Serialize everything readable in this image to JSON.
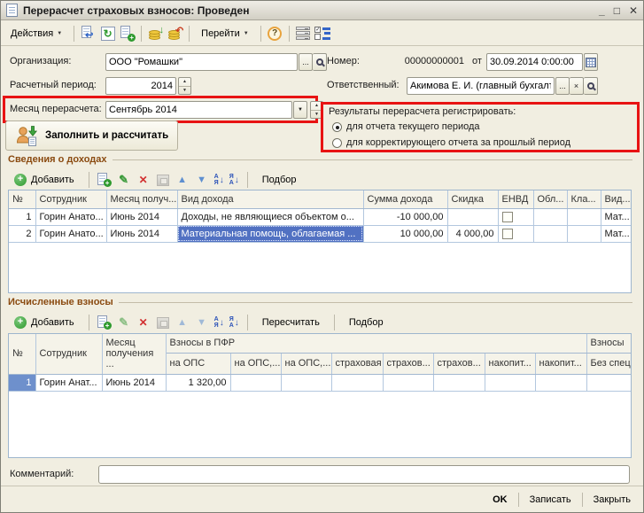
{
  "window": {
    "title": "Перерасчет страховых взносов: Проведен"
  },
  "icons": {
    "minimize": "_",
    "maximize": "□",
    "close": "✕",
    "dropdown": "▼",
    "spin_up": "▲",
    "spin_down": "▼",
    "refresh": "↻",
    "back_arrow": "↩",
    "down_arrow": "↓",
    "undo_arrow": "↶",
    "plus": "+",
    "edit": "✎",
    "delete": "✕",
    "help": "?",
    "ellipsis": "...",
    "clear": "×",
    "check": "✓",
    "sort_a": "А",
    "sort_ya": "Я",
    "sort_arrow": "↓",
    "arrow_up": "▲",
    "arrow_down": "▼"
  },
  "toolbar": {
    "actions": "Действия",
    "goto": "Перейти"
  },
  "form": {
    "org_label": "Организация:",
    "org_value": "ООО \"Ромашки\"",
    "period_label": "Расчетный период:",
    "period_value": "2014",
    "month_label": "Месяц перерасчета:",
    "month_value": "Сентябрь 2014",
    "number_label": "Номер:",
    "number_value": "00000000001",
    "date_prefix": "от",
    "date_value": "30.09.2014 0:00:00",
    "responsible_label": "Ответственный:",
    "responsible_value": "Акимова Е. И. (главный бухгалте",
    "fill_button": "Заполнить и рассчитать"
  },
  "register": {
    "label": "Результаты перерасчета регистрировать:",
    "option_current": "для отчета текущего периода",
    "option_correction": "для корректирующего отчета за прошлый период"
  },
  "income": {
    "title": "Сведения о доходах",
    "add": "Добавить",
    "pick": "Подбор",
    "columns": [
      "№",
      "Сотрудник",
      "Месяц получ...",
      "Вид дохода",
      "Сумма дохода",
      "Скидка",
      "ЕНВД",
      "Обл...",
      "Кла...",
      "Вид..."
    ],
    "rows": [
      {
        "num": "1",
        "employee": "Горин Анато...",
        "month": "Июнь 2014",
        "type": "Доходы, не являющиеся объектом о...",
        "amount": "-10 000,00",
        "discount": "",
        "extra": "Мат..."
      },
      {
        "num": "2",
        "employee": "Горин Анато...",
        "month": "Июнь 2014",
        "type": "Материальная помощь, облагаемая ...",
        "amount": "10 000,00",
        "discount": "4 000,00",
        "extra": "Мат..."
      }
    ]
  },
  "contributions": {
    "title": "Исчисленные взносы",
    "add": "Добавить",
    "recalc": "Пересчитать",
    "pick": "Подбор",
    "group_pfr": "Взносы в ПФР",
    "group_other": "Взносы",
    "col_num": "№",
    "col_employee": "Сотрудник",
    "col_month": "Месяц получения ...",
    "subcolumns": [
      "на ОПС",
      "на ОПС,...",
      "на ОПС,...",
      "страховая",
      "страхов...",
      "страхов...",
      "накопит...",
      "накопит...",
      "Без спец..."
    ],
    "rows": [
      {
        "num": "1",
        "employee": "Горин Анат...",
        "month": "Июнь 2014",
        "ops": "1 320,00"
      }
    ]
  },
  "footer": {
    "comment_label": "Комментарий:",
    "ok": "OK",
    "save": "Записать",
    "close": "Закрыть"
  }
}
